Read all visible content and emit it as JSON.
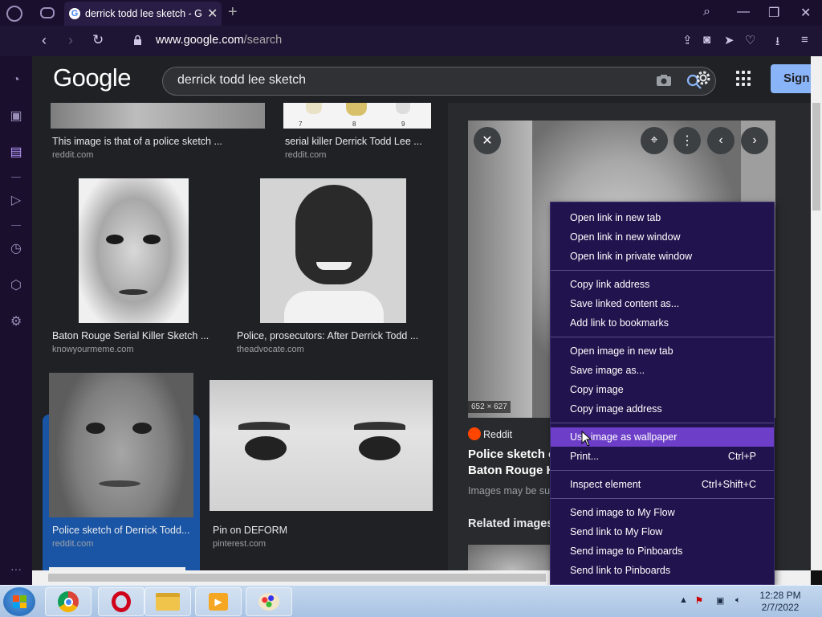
{
  "browser": {
    "tab_title": "derrick todd lee sketch - Go",
    "url_host": "www.google.com",
    "url_path": "/search"
  },
  "google": {
    "logo": "Google",
    "search_query": "derrick todd lee sketch",
    "signin_label": "Sign"
  },
  "results": [
    {
      "title": "This image is that of a police sketch ...",
      "source": "reddit.com"
    },
    {
      "title": "serial killer Derrick Todd Lee ...",
      "source": "reddit.com"
    },
    {
      "title": "Baton Rouge Serial Killer Sketch ...",
      "source": "knowyourmeme.com"
    },
    {
      "title": "Police, prosecutors: After Derrick Todd ...",
      "source": "theadvocate.com"
    },
    {
      "title": "Police sketch of Derrick Todd...",
      "source": "reddit.com"
    },
    {
      "title": "Pin on DEFORM",
      "source": "pinterest.com"
    }
  ],
  "lineup_numbers": [
    "7",
    "8",
    "9"
  ],
  "preview": {
    "dimensions": "652 × 627",
    "source": "Reddit",
    "title_line1": "Police sketch of",
    "title_line2": "Baton Rouge Ki",
    "note": "Images may be su",
    "related": "Related images"
  },
  "context_menu": {
    "groups": [
      [
        "Open link in new tab",
        "Open link in new window",
        "Open link in private window"
      ],
      [
        "Copy link address",
        "Save linked content as...",
        "Add link to bookmarks"
      ],
      [
        "Open image in new tab",
        "Save image as...",
        "Copy image",
        "Copy image address"
      ],
      [
        "Use image as wallpaper",
        "Print..."
      ],
      [
        "Inspect element"
      ],
      [
        "Send image to My Flow",
        "Send link to My Flow",
        "Send image to Pinboards",
        "Send link to Pinboards"
      ]
    ],
    "print_shortcut": "Ctrl+P",
    "inspect_shortcut": "Ctrl+Shift+C",
    "highlighted": "Use image as wallpaper"
  },
  "taskbar": {
    "time": "12:28 PM",
    "date": "2/7/2022"
  },
  "colors": {
    "opera_dark": "#1b0f2e",
    "menu_bg": "#21134d",
    "menu_highlight": "#6d3fc8",
    "selection_blue": "#1a55a5"
  }
}
